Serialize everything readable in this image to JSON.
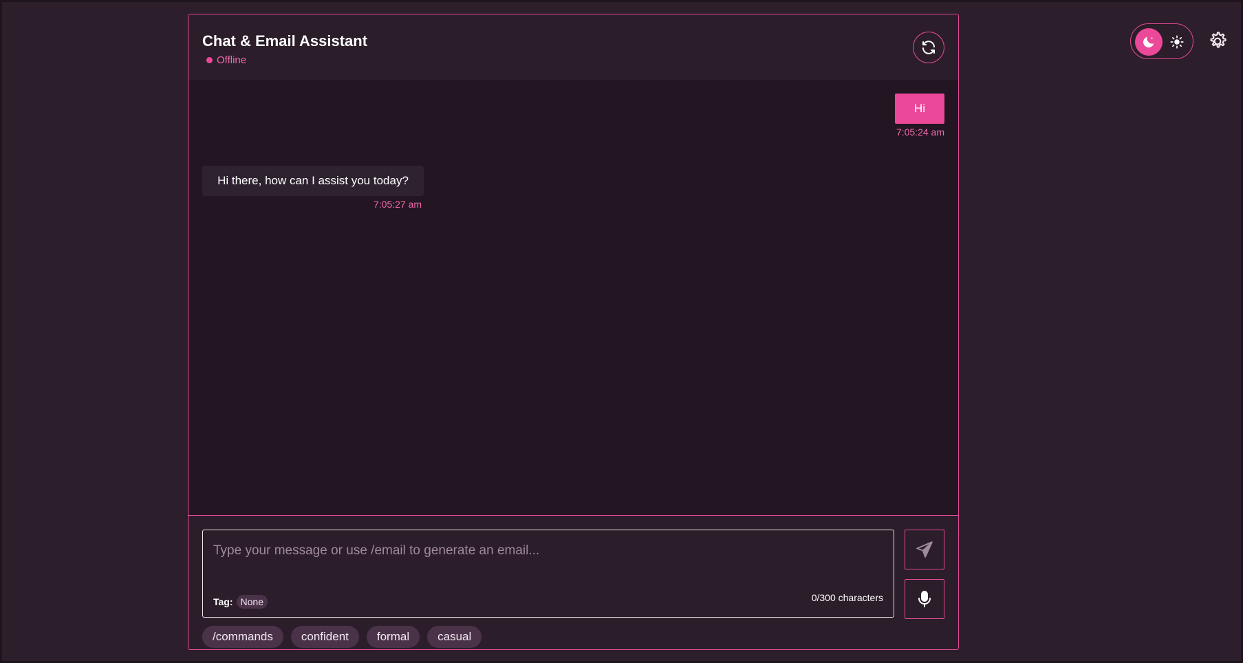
{
  "header": {
    "title": "Chat & Email Assistant",
    "status": "Offline",
    "refresh_icon": "refresh-icon"
  },
  "messages": [
    {
      "role": "user",
      "text": "Hi",
      "time": "7:05:24 am"
    },
    {
      "role": "assistant",
      "text": "Hi there, how can I assist you today?",
      "time": "7:05:27 am"
    }
  ],
  "composer": {
    "placeholder": "Type your message or use /email to generate an email...",
    "value": "",
    "tag_label": "Tag:",
    "tag_value": "None",
    "char_count": "0/300 characters",
    "send_icon": "send-icon",
    "mic_icon": "microphone-icon"
  },
  "chips": [
    "/commands",
    "confident",
    "formal",
    "casual"
  ],
  "theme": {
    "active": "dark",
    "dark_icon": "moon-icon",
    "light_icon": "sun-icon"
  },
  "settings_icon": "gear-icon",
  "colors": {
    "accent": "#ec4899",
    "background": "#2c1e2b",
    "panel": "#241522"
  }
}
